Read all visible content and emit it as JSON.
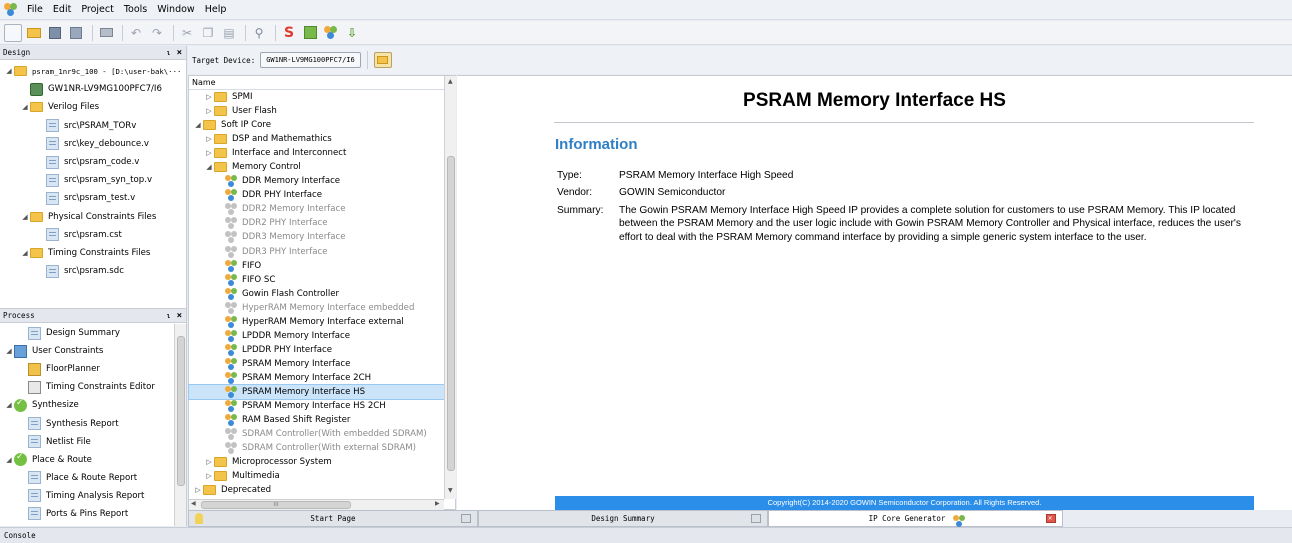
{
  "menu": [
    "File",
    "Edit",
    "Project",
    "Tools",
    "Window",
    "Help"
  ],
  "design_panel": {
    "title": "Design",
    "tree": [
      {
        "label": "psram_1nr9c_100 - [D:\\user-bak\\···",
        "indent": 0,
        "icon": "folder-icon",
        "arrow": "◢",
        "mono": true
      },
      {
        "label": "GW1NR-LV9MG100PFC7/I6",
        "indent": 1,
        "icon": "chip-icon",
        "arrow": ""
      },
      {
        "label": "Verilog Files",
        "indent": 1,
        "icon": "folder-icon",
        "arrow": "◢"
      },
      {
        "label": "src\\PSRAM_TORv",
        "indent": 2,
        "icon": "file-icon",
        "arrow": ""
      },
      {
        "label": "src\\key_debounce.v",
        "indent": 2,
        "icon": "file-icon",
        "arrow": ""
      },
      {
        "label": "src\\psram_code.v",
        "indent": 2,
        "icon": "file-icon",
        "arrow": ""
      },
      {
        "label": "src\\psram_syn_top.v",
        "indent": 2,
        "icon": "file-icon",
        "arrow": ""
      },
      {
        "label": "src\\psram_test.v",
        "indent": 2,
        "icon": "file-icon",
        "arrow": ""
      },
      {
        "label": "Physical Constraints Files",
        "indent": 1,
        "icon": "folder-icon",
        "arrow": "◢"
      },
      {
        "label": "src\\psram.cst",
        "indent": 2,
        "icon": "file-icon",
        "arrow": ""
      },
      {
        "label": "Timing Constraints Files",
        "indent": 1,
        "icon": "folder-icon",
        "arrow": "◢"
      },
      {
        "label": "src\\psram.sdc",
        "indent": 2,
        "icon": "file-icon",
        "arrow": ""
      }
    ]
  },
  "process_panel": {
    "title": "Process",
    "tree": [
      {
        "label": "Design Summary",
        "indent": 1,
        "icon": "summary-icon",
        "arrow": ""
      },
      {
        "label": "User Constraints",
        "indent": 0,
        "icon": "constraints-icon",
        "arrow": "◢"
      },
      {
        "label": "FloorPlanner",
        "indent": 1,
        "icon": "floorplanner-icon",
        "arrow": ""
      },
      {
        "label": "Timing Constraints Editor",
        "indent": 1,
        "icon": "timing-editor-icon",
        "arrow": ""
      },
      {
        "label": "Synthesize",
        "indent": 0,
        "icon": "check-icon",
        "arrow": "◢"
      },
      {
        "label": "Synthesis Report",
        "indent": 1,
        "icon": "file-icon",
        "arrow": ""
      },
      {
        "label": "Netlist File",
        "indent": 1,
        "icon": "file-icon",
        "arrow": ""
      },
      {
        "label": "Place & Route",
        "indent": 0,
        "icon": "check-icon",
        "arrow": "◢"
      },
      {
        "label": "Place & Route Report",
        "indent": 1,
        "icon": "file-icon",
        "arrow": ""
      },
      {
        "label": "Timing Analysis Report",
        "indent": 1,
        "icon": "file-icon",
        "arrow": ""
      },
      {
        "label": "Ports & Pins Report",
        "indent": 1,
        "icon": "file-icon",
        "arrow": ""
      }
    ]
  },
  "target_device": {
    "label": "Target Device:",
    "value": "GW1NR-LV9MG100PFC7/I6"
  },
  "ip_tree": {
    "header": "Name",
    "hscroll_grip": "III",
    "items": [
      {
        "label": "SPMI",
        "indent": 1,
        "type": "folder",
        "arrow": "▷",
        "dim": false
      },
      {
        "label": "User Flash",
        "indent": 1,
        "type": "folder",
        "arrow": "▷",
        "dim": false
      },
      {
        "label": "Soft IP Core",
        "indent": 0,
        "type": "folder",
        "arrow": "◢",
        "dim": false
      },
      {
        "label": "DSP and Mathemathics",
        "indent": 1,
        "type": "folder",
        "arrow": "▷",
        "dim": false
      },
      {
        "label": "Interface and Interconnect",
        "indent": 1,
        "type": "folder",
        "arrow": "▷",
        "dim": false
      },
      {
        "label": "Memory Control",
        "indent": 1,
        "type": "folder",
        "arrow": "◢",
        "dim": false
      },
      {
        "label": "DDR Memory Interface",
        "indent": 2,
        "type": "ip",
        "arrow": "",
        "dim": false
      },
      {
        "label": "DDR PHY Interface",
        "indent": 2,
        "type": "ip",
        "arrow": "",
        "dim": false
      },
      {
        "label": "DDR2 Memory Interface",
        "indent": 2,
        "type": "ip",
        "arrow": "",
        "dim": true
      },
      {
        "label": "DDR2 PHY Interface",
        "indent": 2,
        "type": "ip",
        "arrow": "",
        "dim": true
      },
      {
        "label": "DDR3 Memory Interface",
        "indent": 2,
        "type": "ip",
        "arrow": "",
        "dim": true
      },
      {
        "label": "DDR3 PHY Interface",
        "indent": 2,
        "type": "ip",
        "arrow": "",
        "dim": true
      },
      {
        "label": "FIFO",
        "indent": 2,
        "type": "ip",
        "arrow": "",
        "dim": false
      },
      {
        "label": "FIFO SC",
        "indent": 2,
        "type": "ip",
        "arrow": "",
        "dim": false
      },
      {
        "label": "Gowin Flash Controller",
        "indent": 2,
        "type": "ip",
        "arrow": "",
        "dim": false
      },
      {
        "label": "HyperRAM Memory Interface embedded",
        "indent": 2,
        "type": "ip",
        "arrow": "",
        "dim": true
      },
      {
        "label": "HyperRAM Memory Interface external",
        "indent": 2,
        "type": "ip",
        "arrow": "",
        "dim": false
      },
      {
        "label": "LPDDR Memory Interface",
        "indent": 2,
        "type": "ip",
        "arrow": "",
        "dim": false
      },
      {
        "label": "LPDDR PHY Interface",
        "indent": 2,
        "type": "ip",
        "arrow": "",
        "dim": false
      },
      {
        "label": "PSRAM Memory Interface",
        "indent": 2,
        "type": "ip",
        "arrow": "",
        "dim": false
      },
      {
        "label": "PSRAM Memory Interface 2CH",
        "indent": 2,
        "type": "ip",
        "arrow": "",
        "dim": false
      },
      {
        "label": "PSRAM Memory Interface HS",
        "indent": 2,
        "type": "ip",
        "arrow": "",
        "dim": false,
        "selected": true
      },
      {
        "label": "PSRAM Memory Interface HS 2CH",
        "indent": 2,
        "type": "ip",
        "arrow": "",
        "dim": false
      },
      {
        "label": "RAM Based Shift Register",
        "indent": 2,
        "type": "ip",
        "arrow": "",
        "dim": false
      },
      {
        "label": "SDRAM Controller(With embedded SDRAM)",
        "indent": 2,
        "type": "ip",
        "arrow": "",
        "dim": true
      },
      {
        "label": "SDRAM Controller(With external SDRAM)",
        "indent": 2,
        "type": "ip",
        "arrow": "",
        "dim": true
      },
      {
        "label": "Microprocessor System",
        "indent": 1,
        "type": "folder",
        "arrow": "▷",
        "dim": false
      },
      {
        "label": "Multimedia",
        "indent": 1,
        "type": "folder",
        "arrow": "▷",
        "dim": false
      },
      {
        "label": "Deprecated",
        "indent": 0,
        "type": "folder",
        "arrow": "▷",
        "dim": false
      }
    ]
  },
  "detail": {
    "title": "PSRAM Memory Interface HS",
    "section": "Information",
    "rows": [
      {
        "key": "Type:",
        "value": "PSRAM Memory Interface High Speed"
      },
      {
        "key": "Vendor:",
        "value": "GOWIN Semiconductor"
      },
      {
        "key": "Summary:",
        "value": "The Gowin PSRAM Memory Interface High Speed IP provides a complete solution for customers to use PSRAM Memory. This IP located between the PSRAM Memory and the user logic include with Gowin PSRAM Memory Controller and Physical interface, reduces the user's effort to deal with the PSRAM Memory command interface by providing a simple generic system interface to the user."
      }
    ],
    "footer": "Copyright(C) 2014-2020 GOWIN Semiconductor Corporation. All Rights Reserved."
  },
  "tabs": [
    {
      "label": "Start Page",
      "active": false
    },
    {
      "label": "Design Summary",
      "active": false
    },
    {
      "label": "IP Core Generator",
      "active": true
    }
  ],
  "console": {
    "label": "Console"
  },
  "colors": {
    "accent": "#2b8ee8",
    "section_title": "#2f7fc4",
    "selection": "#cce4fa"
  }
}
